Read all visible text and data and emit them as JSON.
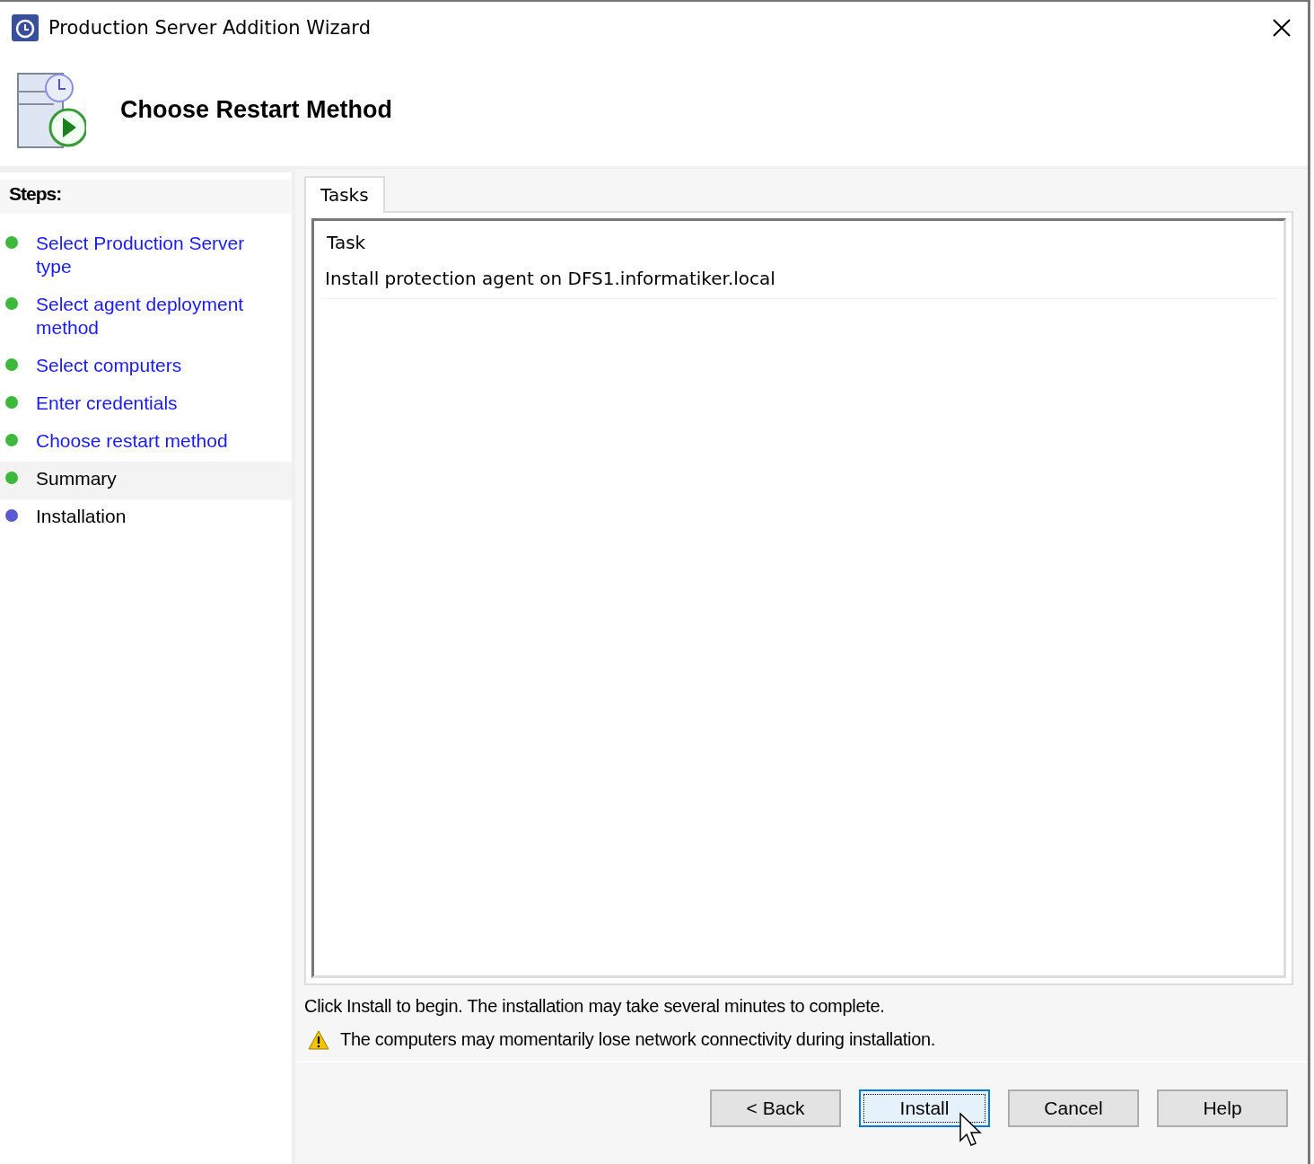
{
  "window": {
    "title": "Production Server Addition Wizard"
  },
  "header": {
    "title": "Choose Restart Method"
  },
  "steps": {
    "heading": "Steps:",
    "items": [
      {
        "label": "Select Production Server type",
        "link": true,
        "selected": false,
        "color": "#3cb83c"
      },
      {
        "label": "Select agent deployment method",
        "link": true,
        "selected": false,
        "color": "#3cb83c"
      },
      {
        "label": "Select computers",
        "link": true,
        "selected": false,
        "color": "#3cb83c"
      },
      {
        "label": "Enter credentials",
        "link": true,
        "selected": false,
        "color": "#3cb83c"
      },
      {
        "label": "Choose restart method",
        "link": true,
        "selected": false,
        "color": "#3cb83c"
      },
      {
        "label": "Summary",
        "link": false,
        "selected": true,
        "color": "#3cb83c"
      },
      {
        "label": "Installation",
        "link": false,
        "selected": false,
        "color": "#5a5ad0"
      }
    ]
  },
  "tabs": [
    {
      "label": "Tasks",
      "selected": true
    }
  ],
  "table": {
    "columns": [
      "Task"
    ],
    "rows": [
      [
        "Install protection agent on DFS1.informatiker.local"
      ]
    ]
  },
  "info": "Click Install to begin. The installation may take several minutes to complete.",
  "warning": "The computers may momentarily lose network connectivity during installation.",
  "buttons": [
    {
      "label": "< Back",
      "default": false
    },
    {
      "label": "Install",
      "default": true
    },
    {
      "label": "Cancel",
      "default": false
    },
    {
      "label": "Help",
      "default": false
    }
  ]
}
